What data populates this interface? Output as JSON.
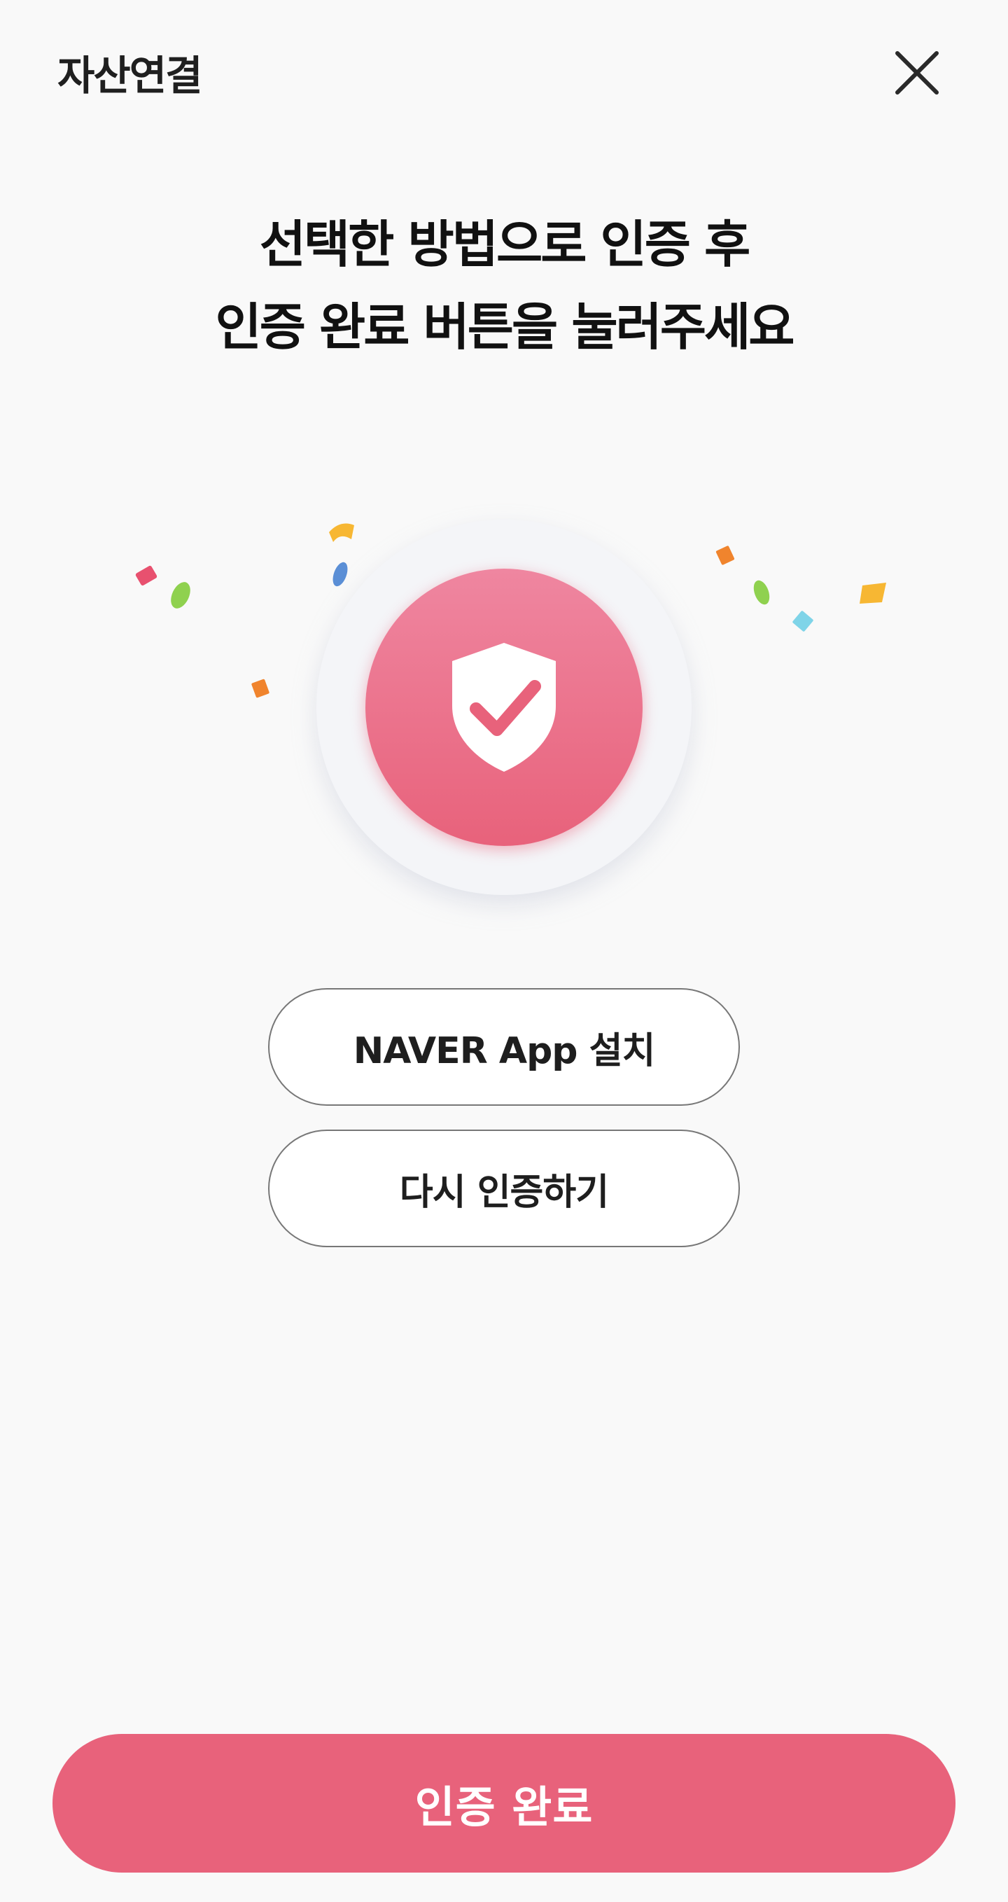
{
  "header": {
    "title": "자산연결",
    "close_icon": "close-icon"
  },
  "headline": {
    "line1": "선택한 방법으로 인증 후",
    "line2": "인증 완료 버튼을 눌러주세요"
  },
  "hero": {
    "icon": "shield-check-icon",
    "accent_color": "#e8627b",
    "confetti_colors": [
      "#e8516f",
      "#8fd14f",
      "#f7b733",
      "#5b8fd6",
      "#f0842d",
      "#7fd4e8"
    ]
  },
  "buttons": {
    "install_naver": "NAVER App 설치",
    "retry_auth": "다시 인증하기",
    "complete": "인증 완료"
  }
}
